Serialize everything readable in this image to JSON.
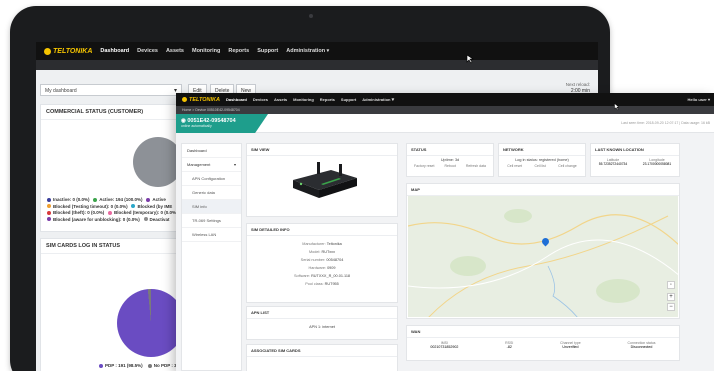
{
  "back_window": {
    "logo": "TELTONIKA",
    "nav": [
      "Dashboard",
      "Devices",
      "Assets",
      "Monitoring",
      "Reports",
      "Support",
      "Administration"
    ],
    "dashboard_select": "My dashboard",
    "buttons": [
      "Edit",
      "Delete",
      "New"
    ],
    "reload_label": "Next reload:",
    "reload_value": "2:00 min",
    "commercial_title": "COMMERCIAL STATUS (CUSTOMER)",
    "commercial_legend": [
      {
        "label": "Inactive: 0 (0.0%)",
        "color": "#3a3f9c"
      },
      {
        "label": "Active: 194 (100.0%)",
        "color": "#3aa34a"
      },
      {
        "label": "Active",
        "color": "#7a3ca8"
      },
      {
        "label": "Blocked (Testing timeout): 0 (0.0%)",
        "color": "#f0a030"
      },
      {
        "label": "Blocked (by IME",
        "color": "#2aa7c9"
      },
      {
        "label": "Blocked (theft): 0 (0.0%)",
        "color": "#d9383a"
      },
      {
        "label": "Blocked (temporary): 0 (0.0%)",
        "color": "#e86aa0"
      },
      {
        "label": "Blocked (aware for unblocking): 0 (0.0%)",
        "color": "#7a3ca8"
      },
      {
        "label": "Deactivat",
        "color": "#8c8c8c"
      }
    ],
    "simlog_title": "SIM CARDS LOG IN STATUS",
    "simlog_legend": [
      {
        "label": "PDP : 191 (98.5%)",
        "color": "#6a4cc2"
      },
      {
        "label": "No PDP : 3 (1",
        "color": "#7a7a7a"
      }
    ]
  },
  "front_window": {
    "logo": "TELTONIKA",
    "nav": [
      "Dashboard",
      "Devices",
      "Assets",
      "Monitoring",
      "Reports",
      "Support",
      "Administration"
    ],
    "user": "Hello user",
    "breadcrumb": "Home > Device 00510E42-09548704",
    "device_id": "0051E42-09548704",
    "device_sub": "online automatically",
    "last_seen": "Last seen time: 2018-09-20 12:07:17  |  Data usage: 16 kB",
    "menu": [
      {
        "label": "Dashboard",
        "sub": false,
        "sel": false
      },
      {
        "label": "Management",
        "sub": false,
        "sel": false,
        "caret": "▾"
      },
      {
        "label": "APN Configuration",
        "sub": true,
        "sel": false
      },
      {
        "label": "Generic data",
        "sub": true,
        "sel": false
      },
      {
        "label": "SIM info",
        "sub": true,
        "sel": true
      },
      {
        "label": "TR-069 Settings",
        "sub": true,
        "sel": false
      },
      {
        "label": "Wireless LAN",
        "sub": true,
        "sel": false
      }
    ],
    "sim_view_title": "SIM VIEW",
    "sim_info_title": "SIM DETAILED INFO",
    "sim_info": [
      {
        "k": "Manufacturer:",
        "v": "Teltonika"
      },
      {
        "k": "Model:",
        "v": "RUTxxx"
      },
      {
        "k": "Serial number:",
        "v": "00548704"
      },
      {
        "k": "Hardware:",
        "v": "0909"
      },
      {
        "k": "Software:",
        "v": "RUTXXX_R_00.01.118"
      },
      {
        "k": "Pool class:",
        "v": "RUT955"
      }
    ],
    "apn_title": "APN LIST",
    "apn_value": "APN 1: internet",
    "assoc_title": "ASSOCIATED SIM CARDS",
    "status_title": "STATUS",
    "uptime": "Uptime: 3d",
    "status_btns": [
      "Factory reset",
      "Reboot",
      "Refresh data"
    ],
    "network_title": "NETWORK",
    "login_status": "Log in status: registered (home)",
    "network_btns": [
      "Cell reset",
      "Cell list",
      "Cell change"
    ],
    "location_title": "LAST KNOWN LOCATION",
    "lat_label": "Latitude",
    "lat": "55.7235272440734",
    "lon_label": "Longitude",
    "lon": "23.1700000058081",
    "map_title": "MAP",
    "wan_title": "WAN",
    "wan_cols": [
      {
        "k": "IMSI",
        "v": "00210731852902"
      },
      {
        "k": "RSSI",
        "v": "-82"
      },
      {
        "k": "Channel type",
        "v": "Unverified"
      },
      {
        "k": "Connection status",
        "v": "Disconnected"
      }
    ]
  }
}
